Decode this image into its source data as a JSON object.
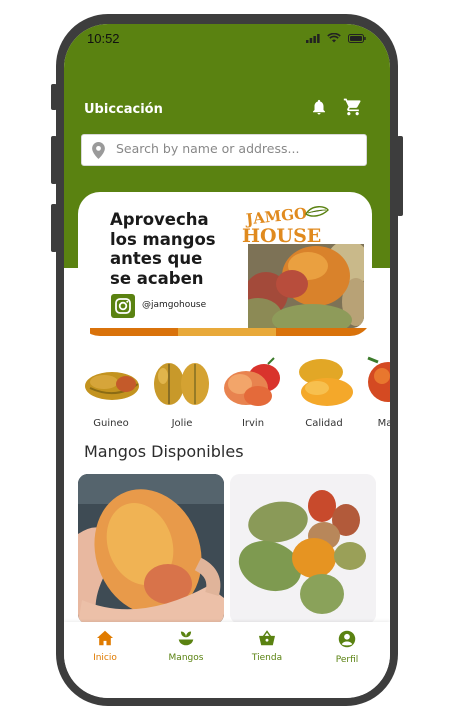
{
  "status_bar": {
    "time": "10:52"
  },
  "header": {
    "location_label": "Ubiccación"
  },
  "search": {
    "placeholder": "Search by name or address..."
  },
  "banner": {
    "title_lines": [
      "Aprovecha",
      "los mangos",
      "antes que",
      "se acaben"
    ],
    "instagram_handle": "@jamgohouse",
    "logo_text_top": "JAMGO",
    "logo_text_bottom": "HOUSE"
  },
  "categories": [
    {
      "label": "Guineo"
    },
    {
      "label": "Jolie"
    },
    {
      "label": "Irvin"
    },
    {
      "label": "Calidad"
    },
    {
      "label": "Ma"
    }
  ],
  "section": {
    "title": "Mangos Disponibles"
  },
  "bottom_nav": [
    {
      "label": "Inicio",
      "icon": "home-icon",
      "active": true
    },
    {
      "label": "Mangos",
      "icon": "plant-icon",
      "active": false
    },
    {
      "label": "Tienda",
      "icon": "basket-icon",
      "active": false
    },
    {
      "label": "Perfil",
      "icon": "user-icon",
      "active": false
    }
  ],
  "colors": {
    "primary": "#5a8211",
    "accent": "#e07b00",
    "nav_inactive": "#5a8211"
  }
}
